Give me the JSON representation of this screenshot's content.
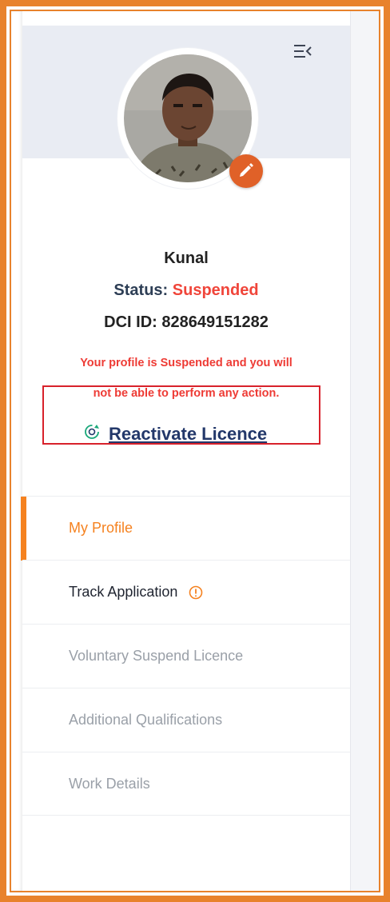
{
  "profile": {
    "name": "Kunal",
    "status_label": "Status:",
    "status_value": "Suspended",
    "dci_label": "DCI ID:",
    "dci_value": "828649151282"
  },
  "notice": {
    "line1": "Your profile is Suspended and you will",
    "line2": "not be able to perform any action.",
    "reactivate_label": "Reactivate Licence"
  },
  "menu": {
    "items": [
      {
        "label": "My Profile",
        "state": "active"
      },
      {
        "label": "Track Application",
        "state": "enabled",
        "icon": "info-icon"
      },
      {
        "label": "Voluntary Suspend Licence",
        "state": "disabled"
      },
      {
        "label": "Additional Qualifications",
        "state": "disabled"
      },
      {
        "label": "Work Details",
        "state": "disabled"
      }
    ]
  },
  "icons": {
    "collapse": "menu-collapse-icon",
    "edit": "pencil-icon",
    "reactivate": "refresh-icon",
    "info": "info-icon"
  },
  "colors": {
    "frame": "#e8822c",
    "accent": "#f58220",
    "danger": "#ee3b35",
    "edit_button": "#e06128",
    "link": "#23386a",
    "header_band": "#e9ecf3"
  }
}
